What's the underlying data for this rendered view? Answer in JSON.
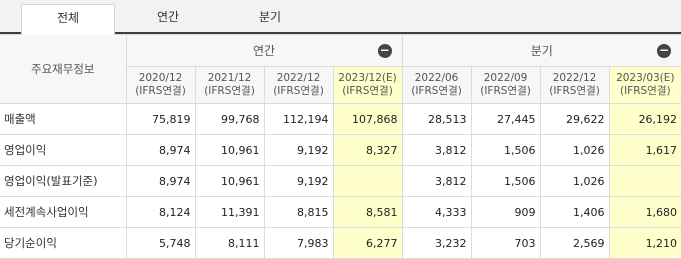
{
  "tabs": [
    {
      "label": "전체",
      "active": true
    },
    {
      "label": "연간",
      "active": false
    },
    {
      "label": "분기",
      "active": false
    }
  ],
  "table": {
    "corner_label": "주요재무정보",
    "groups": [
      {
        "label": "연간",
        "collapse_icon": "minus-circle-icon"
      },
      {
        "label": "분기",
        "collapse_icon": "minus-circle-icon"
      }
    ],
    "periods": [
      {
        "date": "2020/12",
        "basis": "(IFRS연결)",
        "estimate": false
      },
      {
        "date": "2021/12",
        "basis": "(IFRS연결)",
        "estimate": false
      },
      {
        "date": "2022/12",
        "basis": "(IFRS연결)",
        "estimate": false
      },
      {
        "date": "2023/12(E)",
        "basis": "(IFRS연결)",
        "estimate": true
      },
      {
        "date": "2022/06",
        "basis": "(IFRS연결)",
        "estimate": false
      },
      {
        "date": "2022/09",
        "basis": "(IFRS연결)",
        "estimate": false
      },
      {
        "date": "2022/12",
        "basis": "(IFRS연결)",
        "estimate": false
      },
      {
        "date": "2023/03(E)",
        "basis": "(IFRS연결)",
        "estimate": true
      }
    ],
    "rows": [
      {
        "label": "매출액",
        "values": [
          "75,819",
          "99,768",
          "112,194",
          "107,868",
          "28,513",
          "27,445",
          "29,622",
          "26,192"
        ]
      },
      {
        "label": "영업이익",
        "values": [
          "8,974",
          "10,961",
          "9,192",
          "8,327",
          "3,812",
          "1,506",
          "1,026",
          "1,617"
        ]
      },
      {
        "label": "영업이익(발표기준)",
        "values": [
          "8,974",
          "10,961",
          "9,192",
          "",
          "3,812",
          "1,506",
          "1,026",
          ""
        ]
      },
      {
        "label": "세전계속사업이익",
        "values": [
          "8,124",
          "11,391",
          "8,815",
          "8,581",
          "4,333",
          "909",
          "1,406",
          "1,680"
        ]
      },
      {
        "label": "당기순이익",
        "values": [
          "5,748",
          "8,111",
          "7,983",
          "6,277",
          "3,232",
          "703",
          "2,569",
          "1,210"
        ]
      }
    ],
    "estimate_color": "#ffffcc"
  }
}
